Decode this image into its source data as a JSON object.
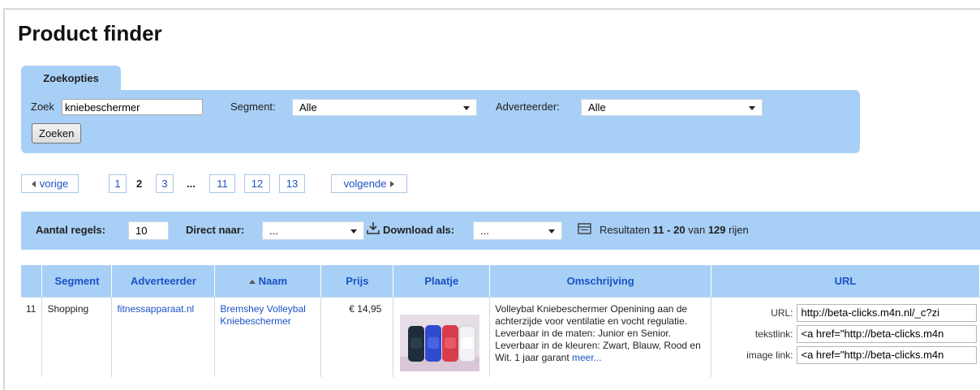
{
  "page": {
    "title": "Product finder"
  },
  "search": {
    "tab_label": "Zoekopties",
    "query_label": "Zoek",
    "query_value": "kniebeschermer",
    "segment_label": "Segment:",
    "segment_value": "Alle",
    "advertiser_label": "Adverteerder:",
    "advertiser_value": "Alle",
    "submit_label": "Zoeken"
  },
  "pager": {
    "prev_label": "vorige",
    "next_label": "volgende",
    "pages": [
      "1",
      "2",
      "3",
      "...",
      "11",
      "12",
      "13"
    ],
    "current": "2"
  },
  "toolbar": {
    "rows_label": "Aantal regels:",
    "rows_value": "10",
    "goto_label": "Direct naar:",
    "goto_value": "...",
    "download_label": "Download als:",
    "download_value": "...",
    "results_prefix": "Resultaten",
    "results_from": "11",
    "results_sep": "-",
    "results_to": "20",
    "results_of": "van",
    "results_total": "129",
    "results_suffix": "rijen"
  },
  "table": {
    "columns": [
      "",
      "Segment",
      "Adverteerder",
      "Naam",
      "Prijs",
      "Plaatje",
      "Omschrijving",
      "URL"
    ],
    "rows": [
      {
        "index": "11",
        "segment": "Shopping",
        "advertiser": "fitnessapparaat.nl",
        "name": "Bremshey Volleybal Kniebeschermer",
        "price": "€ 14,95",
        "description": "Volleybal Kniebeschermer Openining aan de achterzijde voor ventilatie en vocht regulatie. Leverbaar in de maten: Junior en Senior. Leverbaar in de kleuren: Zwart, Blauw, Rood en Wit. 1 jaar garant",
        "more_label": "meer...",
        "url_label": "URL:",
        "url_value": "http://beta-clicks.m4n.nl/_c?zi",
        "textlink_label": "tekstlink:",
        "textlink_value": "<a href=\"http://beta-clicks.m4n",
        "imagelink_label": "image link:",
        "imagelink_value": "<a href=\"http://beta-clicks.m4n"
      }
    ]
  },
  "icons": {
    "download": "download-icon",
    "results": "list-icon",
    "prev": "triangle-left-icon",
    "next": "triangle-right-icon",
    "sort": "sort-ascending-icon"
  },
  "colors": {
    "panel": "#a8cff5",
    "link": "#1a52c5",
    "swatches": [
      "#1f2d3a",
      "#2f4bd0",
      "#d83b4a",
      "#f2f2f4"
    ]
  }
}
